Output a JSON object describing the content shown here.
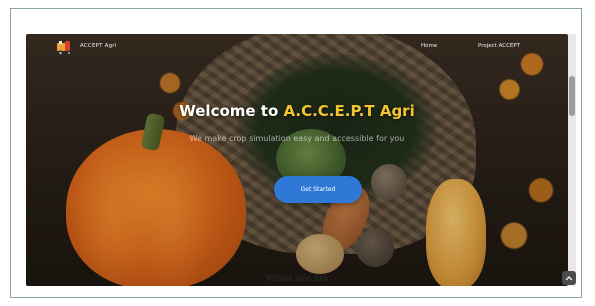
{
  "nav": {
    "brand": "ACCEPT Agri",
    "links": [
      "Home",
      "Project ACCEPT"
    ]
  },
  "hero": {
    "title_prefix": "Welcome to ",
    "title_highlight": "A.C.C.E.P.T Agri",
    "subtitle": "We make crop simulation easy and accessible for you",
    "cta_label": "Get Started"
  },
  "section": {
    "heading": "What We Do"
  },
  "icons": {
    "logo": "tractor-logo-icon",
    "scroll_top": "chevron-up-icon"
  },
  "colors": {
    "brand_highlight": "#f4c431",
    "cta": "#2f78d6",
    "frame_border": "#8aa3a8"
  }
}
